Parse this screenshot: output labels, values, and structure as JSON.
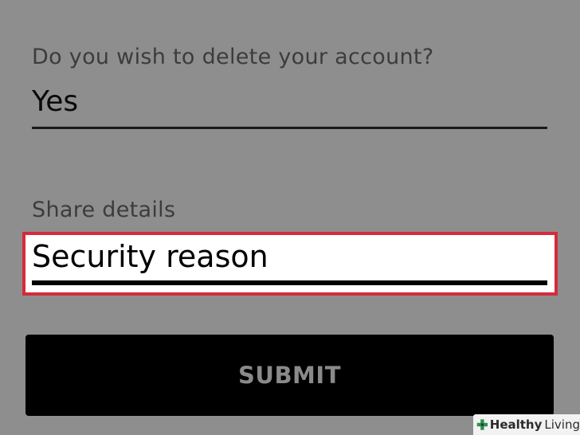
{
  "form": {
    "question_label": "Do you wish to delete your account?",
    "answer_value": "Yes",
    "details_label": "Share details",
    "details_value": "Security reason",
    "submit_label": "SUBMIT"
  },
  "watermark": {
    "brand_primary": "Healthy",
    "brand_secondary": "Living",
    "icon": "plus-cross-icon"
  },
  "colors": {
    "background": "#8e8e8e",
    "highlight_border": "#d62a3a",
    "button": "#000000",
    "button_text": "#8a8a8a",
    "brand_green": "#2f8f4e"
  }
}
